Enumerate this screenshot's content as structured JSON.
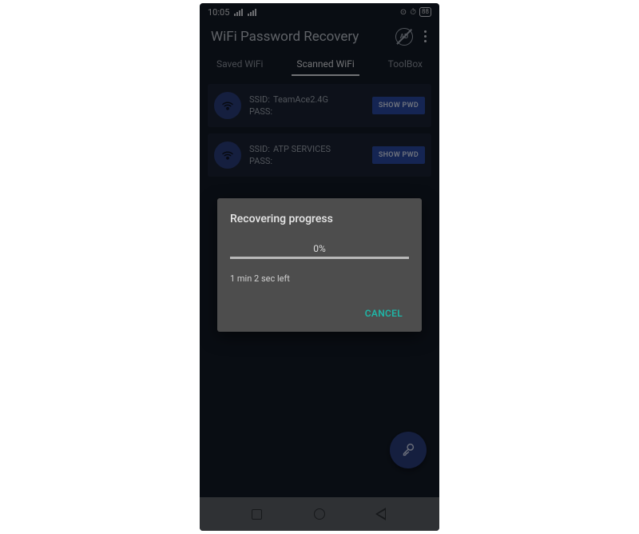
{
  "status": {
    "time": "10:05",
    "battery": "88"
  },
  "app": {
    "title": "WiFi Password Recovery",
    "ad_label": "AD"
  },
  "tabs": {
    "saved": "Saved WiFi",
    "scanned": "Scanned WiFi",
    "toolbox": "ToolBox"
  },
  "labels": {
    "ssid": "SSID:",
    "pass": "PASS:",
    "show_pwd": "SHOW PWD"
  },
  "networks": [
    {
      "ssid": "TeamAce2.4G",
      "pass": ""
    },
    {
      "ssid": "ATP SERVICES",
      "pass": ""
    }
  ],
  "dialog": {
    "title": "Recovering progress",
    "percent": "0%",
    "time_left": "1 min 2 sec left",
    "cancel": "CANCEL"
  }
}
